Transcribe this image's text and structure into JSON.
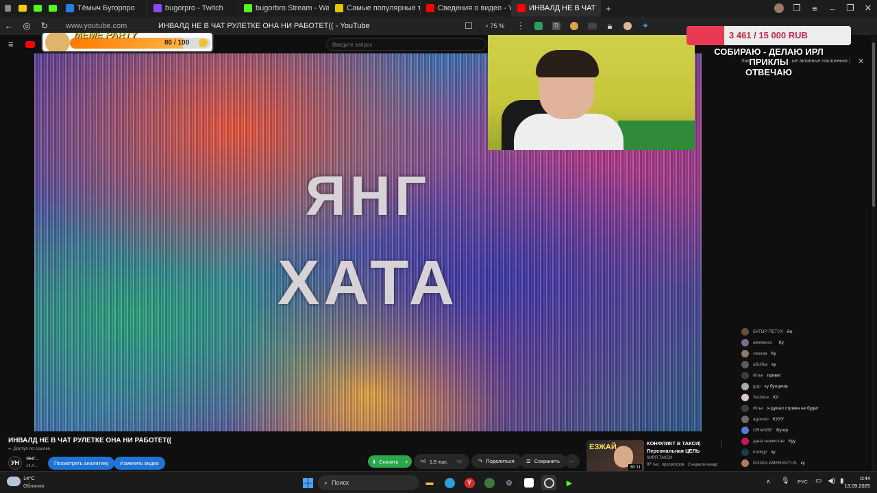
{
  "browser": {
    "tabs": [
      {
        "label": "Тёмыч Бугорпро",
        "color": "#2c7be5"
      },
      {
        "label": "bugorpro - Twitch",
        "color": "#9146ff"
      },
      {
        "label": "bugorbro Stream - Watch",
        "color": "#53fc18"
      },
      {
        "label": "Самые популярные трек",
        "color": "#e6c200"
      },
      {
        "label": "Сведения о видео - YouT",
        "color": "#ff0000"
      },
      {
        "label": "ИНВАЛД НЕ В ЧАТ",
        "color": "#ff0000"
      }
    ],
    "url": "www.youtube.com",
    "page_title": "ИНВАЛД НЕ В ЧАТ РУЛЕТКЕ ОНА НИ РАБОТЕТ(( - YouTube",
    "zoom": "75 %"
  },
  "youtube": {
    "search_placeholder": "Введите запрос",
    "video_title": "ИНВАЛД НЕ В ЧАТ РУЛЕТКЕ ОНА НИ РАБОТЕТ((",
    "visibility": "Доступ по ссылке",
    "channel_name": "ЯНГ...",
    "channel_subs": "14,4 ...",
    "analytics_btn": "Посмотреть аналитику",
    "edit_btn": "Изменить видео",
    "download_btn": "Скачать",
    "likes": "1,5 тыс.",
    "share_btn": "Поделиться",
    "save_btn": "Сохранить",
    "video_overlay_line1": "ЯНГ",
    "video_overlay_line2": "ХАТА"
  },
  "recommended": {
    "title_line1": "КОНФЛИКТ В ТАКСИ|",
    "title_line2": "Персональная ЦЕЛЬ",
    "channel": "КИРЯ ТАКСИ",
    "meta": "87 тыс. просмотров · 2 недели назад",
    "duration": "38:11",
    "thumb_text": "ЕЗЖАЙ"
  },
  "chat": {
    "header_left": "Зак...",
    "header_right": "...ые активные поклонники",
    "messages": [
      {
        "name": "БУГОР ПЕТУХ",
        "text": "йо",
        "color": "#6b4e3d"
      },
      {
        "name": "aleeteess ·",
        "text": "Ку",
        "color": "#7b6b8d"
      },
      {
        "name": "лизкаa",
        "text": "Ку",
        "color": "#8d7b6b"
      },
      {
        "name": "абобка",
        "text": "ку",
        "color": "#5b5b5b"
      },
      {
        "name": "Ильк",
        "text": "привет",
        "color": "#3d3d3d"
      },
      {
        "name": "gup",
        "text": "ку бугорчик",
        "color": "#aaaaaa"
      },
      {
        "name": "Sxolnce",
        "text": "КУ",
        "color": "#d8c8c8"
      },
      {
        "name": "Ильк",
        "text": "я думал стрима не будет",
        "color": "#3d3d3d"
      },
      {
        "name": "agowoo",
        "text": "КУУУ",
        "color": "#6b6b6b"
      },
      {
        "name": "ORANGE",
        "text": "Бугор",
        "color": "#5a7ad8"
      },
      {
        "name": "дана мамистая",
        "text": "Куу",
        "color": "#c2185b"
      },
      {
        "name": "hooligz",
        "text": "ку",
        "color": "#1e3a4a"
      },
      {
        "name": "KONGLAMERANTUS",
        "text": "ку",
        "color": "#b07a5a"
      }
    ]
  },
  "overlay": {
    "meme_title": "MEME PARTY",
    "meme_progress_text": "80 / 100",
    "meme_progress": 0.8,
    "donation_amount": "3 461 / 15 000 RUB",
    "donation_progress": 0.23,
    "stream_caption_line1": "СОБИРАЮ - ДЕЛАЮ ИРЛ ПРИКЛЫ",
    "stream_caption_line2": "ОТВЕЧАЮ"
  },
  "taskbar": {
    "weather_temp": "14°C",
    "weather_desc": "Облачно",
    "search_label": "Поиск",
    "language": "РУС",
    "time": "0:44",
    "date": "13.09.2025"
  }
}
